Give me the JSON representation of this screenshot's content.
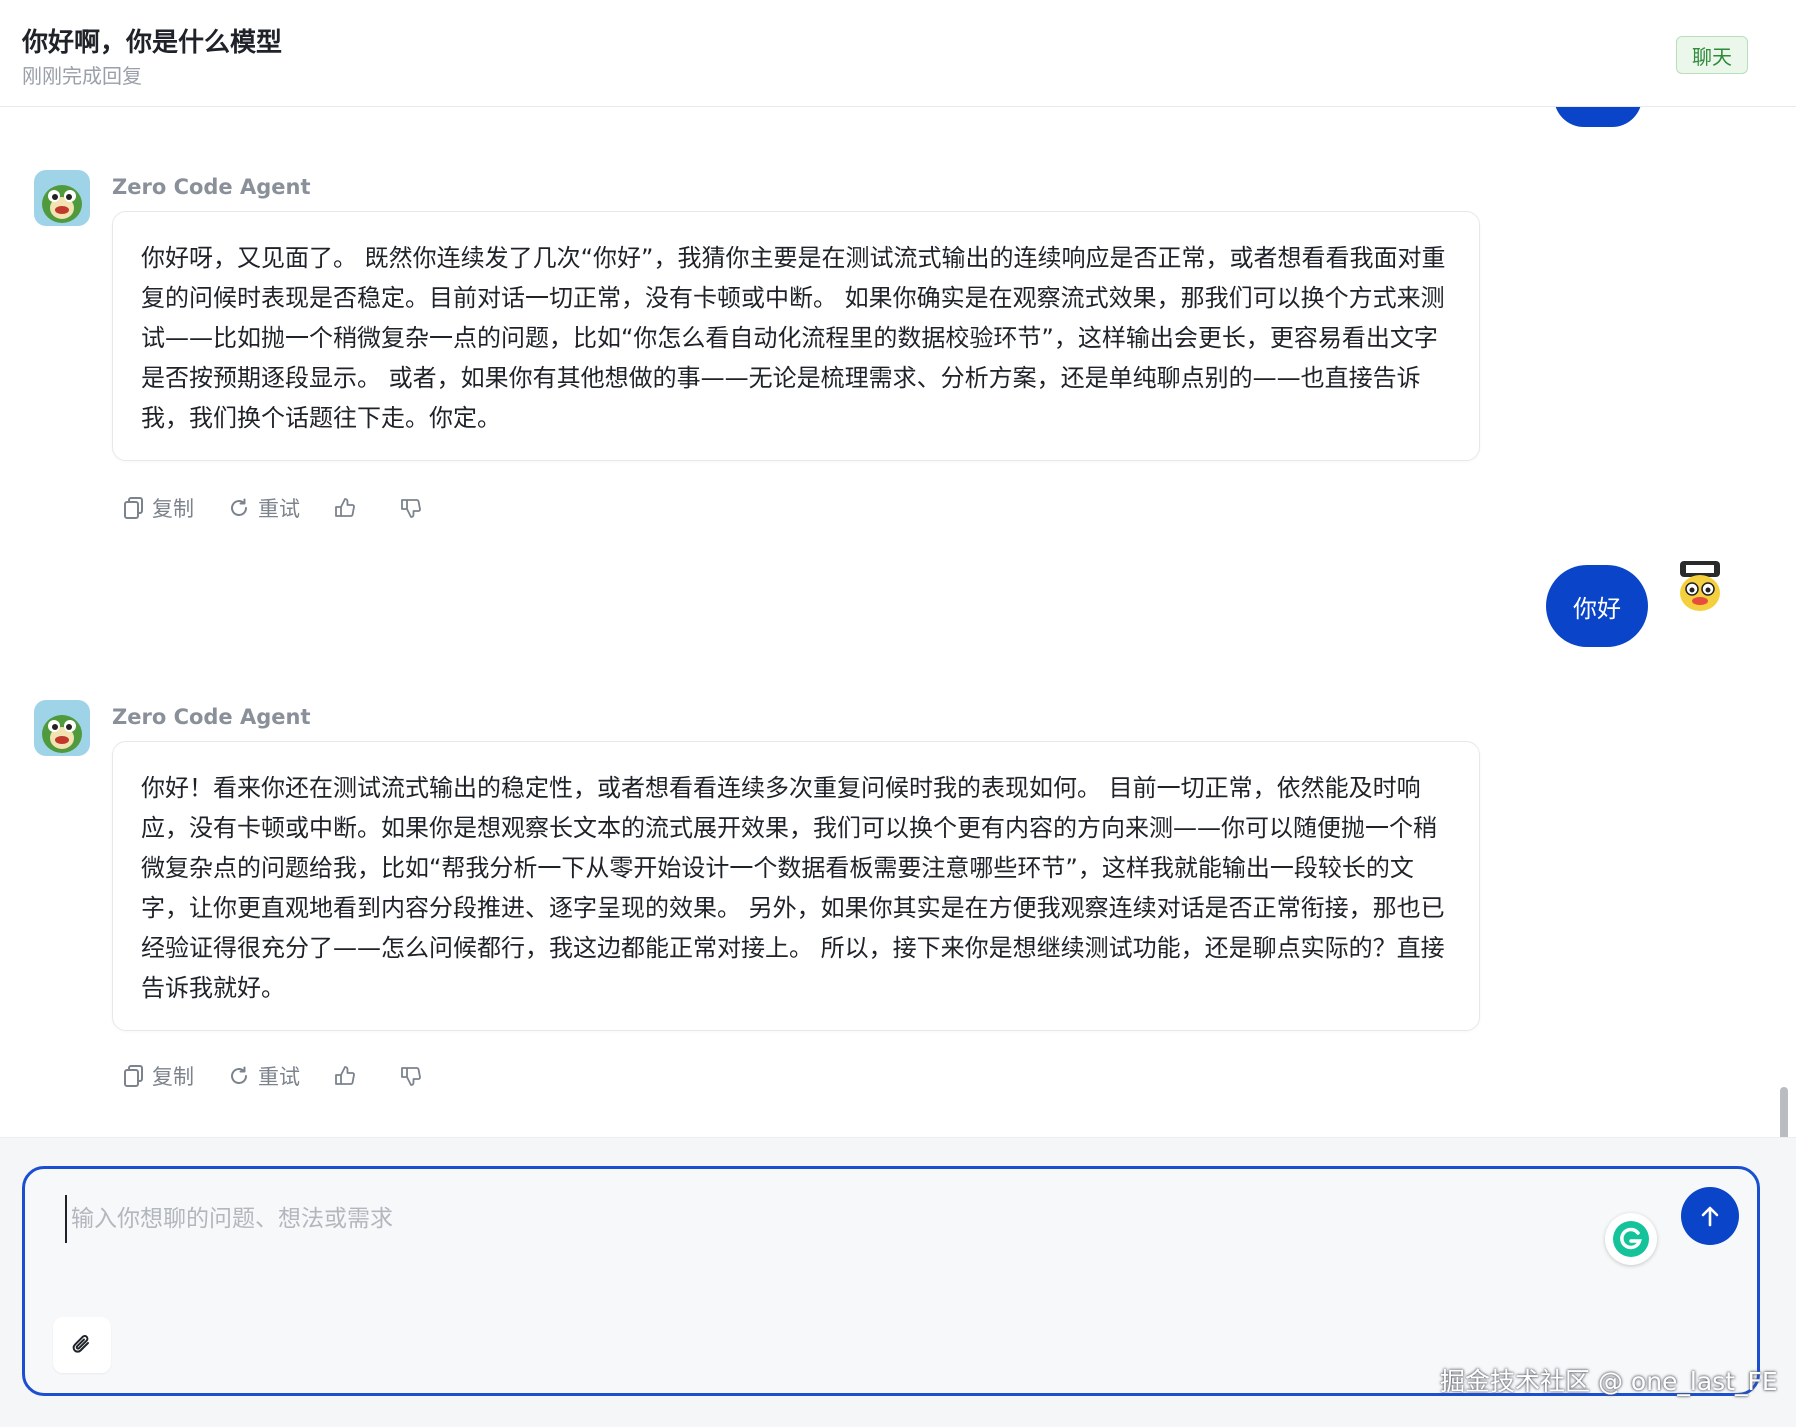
{
  "header": {
    "title": "你好啊，你是什么模型",
    "subtitle": "刚刚完成回复",
    "mode_badge": "聊天"
  },
  "messages": [
    {
      "role": "assistant",
      "name": "Zero Code Agent",
      "text": "你好呀，又见面了。 既然你连续发了几次“你好”，我猜你主要是在测试流式输出的连续响应是否正常，或者想看看我面对重复的问候时表现是否稳定。目前对话一切正常，没有卡顿或中断。 如果你确实是在观察流式效果，那我们可以换个方式来测试——比如抛一个稍微复杂一点的问题，比如“你怎么看自动化流程里的数据校验环节”，这样输出会更长，更容易看出文字是否按预期逐段显示。 或者，如果你有其他想做的事——无论是梳理需求、分析方案，还是单纯聊点别的——也直接告诉我，我们换个话题往下走。你定。",
      "actions": {
        "copy": "复制",
        "retry": "重试"
      }
    },
    {
      "role": "user",
      "text": "你好"
    },
    {
      "role": "assistant",
      "name": "Zero Code Agent",
      "text": "你好！看来你还在测试流式输出的稳定性，或者想看看连续多次重复问候时我的表现如何。 目前一切正常，依然能及时响应，没有卡顿或中断。如果你是想观察长文本的流式展开效果，我们可以换个更有内容的方向来测——你可以随便抛一个稍微复杂点的问题给我，比如“帮我分析一下从零开始设计一个数据看板需要注意哪些环节”，这样我就能输出一段较长的文字，让你更直观地看到内容分段推进、逐字呈现的效果。 另外，如果你其实是在方便我观察连续对话是否正常衔接，那也已经验证得很充分了——怎么问候都行，我这边都能正常对接上。 所以，接下来你是想继续测试功能，还是聊点实际的？直接告诉我就好。",
      "actions": {
        "copy": "复制",
        "retry": "重试"
      }
    }
  ],
  "composer": {
    "placeholder": "输入你想聊的问题、想法或需求",
    "value": ""
  },
  "watermark": "掘金技术社区 @ one_last_FE",
  "colors": {
    "accent": "#0a44c8",
    "badge_bg": "#eaf7ea",
    "badge_text": "#2f8a3a",
    "muted": "#7c838c"
  },
  "icons": {
    "copy": "copy-icon",
    "retry": "refresh-icon",
    "like": "thumbs-up-icon",
    "dislike": "thumbs-down-icon",
    "attach": "paperclip-icon",
    "send": "arrow-up-icon",
    "grammarly": "grammarly-icon"
  }
}
